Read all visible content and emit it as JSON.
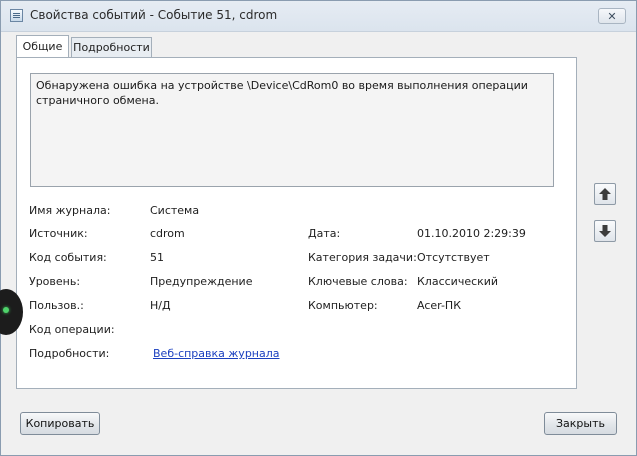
{
  "window": {
    "title": "Свойства событий - Событие 51, cdrom",
    "close_glyph": "✕"
  },
  "tabs": [
    {
      "label": "Общие",
      "active": true
    },
    {
      "label": "Подробности",
      "active": false
    }
  ],
  "description": "Обнаружена ошибка на устройстве \\Device\\CdRom0 во время выполнения операции\nстраничного обмена.",
  "fields": {
    "log_name": {
      "label": "Имя журнала:",
      "value": "Система"
    },
    "source": {
      "label": "Источник:",
      "value": "cdrom"
    },
    "date": {
      "label": "Дата:",
      "value": "01.10.2010 2:29:39"
    },
    "event_id": {
      "label": "Код события:",
      "value": "51"
    },
    "task_category": {
      "label": "Категория задачи:",
      "value": "Отсутствует"
    },
    "level": {
      "label": "Уровень:",
      "value": "Предупреждение"
    },
    "keywords": {
      "label": "Ключевые слова:",
      "value": "Классический"
    },
    "user": {
      "label": "Пользов.:",
      "value": "Н/Д"
    },
    "computer": {
      "label": "Компьютер:",
      "value": "Acer-ПК"
    },
    "opcode": {
      "label": "Код операции:",
      "value": ""
    },
    "more_info": {
      "label": "Подробности:",
      "value": "Веб-справка журнала"
    }
  },
  "side_buttons": {
    "up_icon": "arrow-up-icon",
    "down_icon": "arrow-down-icon"
  },
  "buttons": {
    "copy": "Копировать",
    "close": "Закрыть"
  }
}
